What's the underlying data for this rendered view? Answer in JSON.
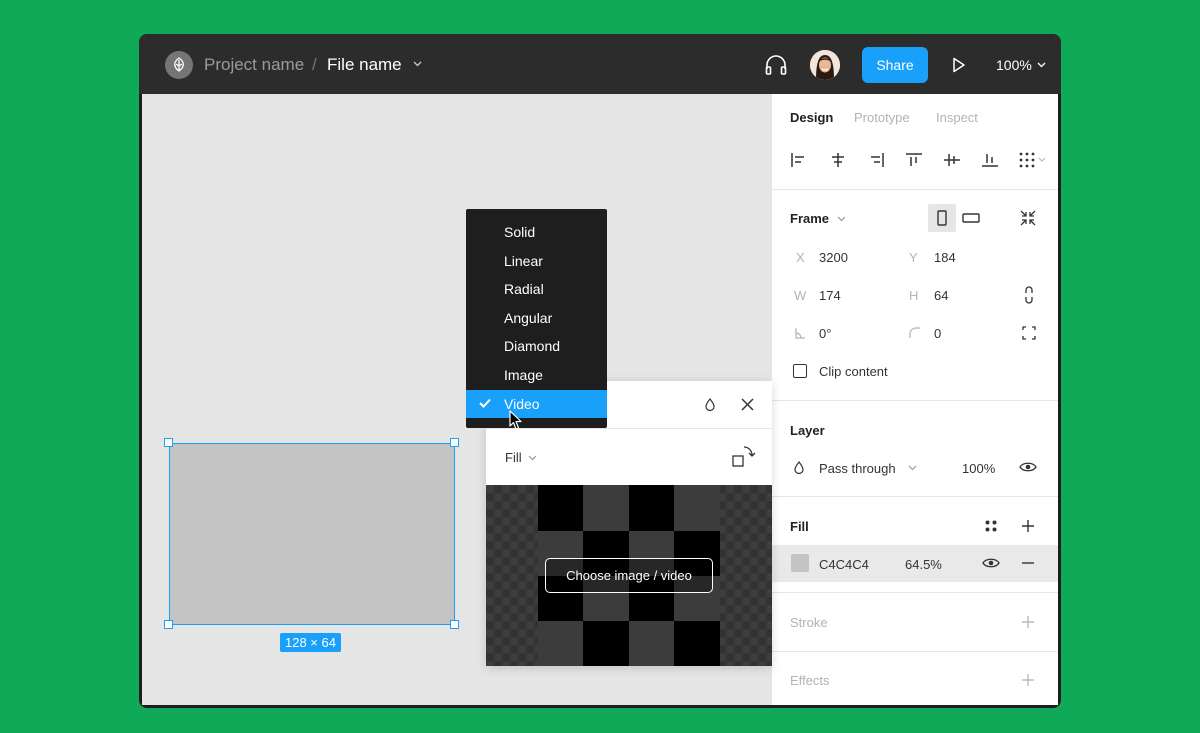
{
  "topbar": {
    "project_name": "Project name",
    "separator": "/",
    "file_name": "File name",
    "share_label": "Share",
    "zoom_level": "100%"
  },
  "canvas": {
    "selection_size": "128 × 64"
  },
  "fill_type_menu": {
    "items": [
      "Solid",
      "Linear",
      "Radial",
      "Angular",
      "Diamond",
      "Image",
      "Video"
    ],
    "selected": "Video"
  },
  "fill_popup": {
    "fill_label": "Fill",
    "choose_label": "Choose image / video"
  },
  "design_panel": {
    "tabs": [
      "Design",
      "Prototype",
      "Inspect"
    ],
    "frame": {
      "title": "Frame",
      "x_label": "X",
      "x": "3200",
      "y_label": "Y",
      "y": "184",
      "w_label": "W",
      "w": "174",
      "h_label": "H",
      "h": "64",
      "rotation": "0°",
      "radius": "0",
      "clip_content_label": "Clip content",
      "clip_content": false
    },
    "layer": {
      "title": "Layer",
      "blend_mode": "Pass through",
      "opacity": "100%"
    },
    "fill": {
      "title": "Fill",
      "hex": "C4C4C4",
      "opacity": "64.5%",
      "color": "#c4c4c4"
    },
    "stroke": {
      "title": "Stroke"
    },
    "effects": {
      "title": "Effects"
    }
  },
  "colors": {
    "accent": "#18a0fb",
    "background": "#0fa958",
    "topbar": "#2c2c2c"
  }
}
